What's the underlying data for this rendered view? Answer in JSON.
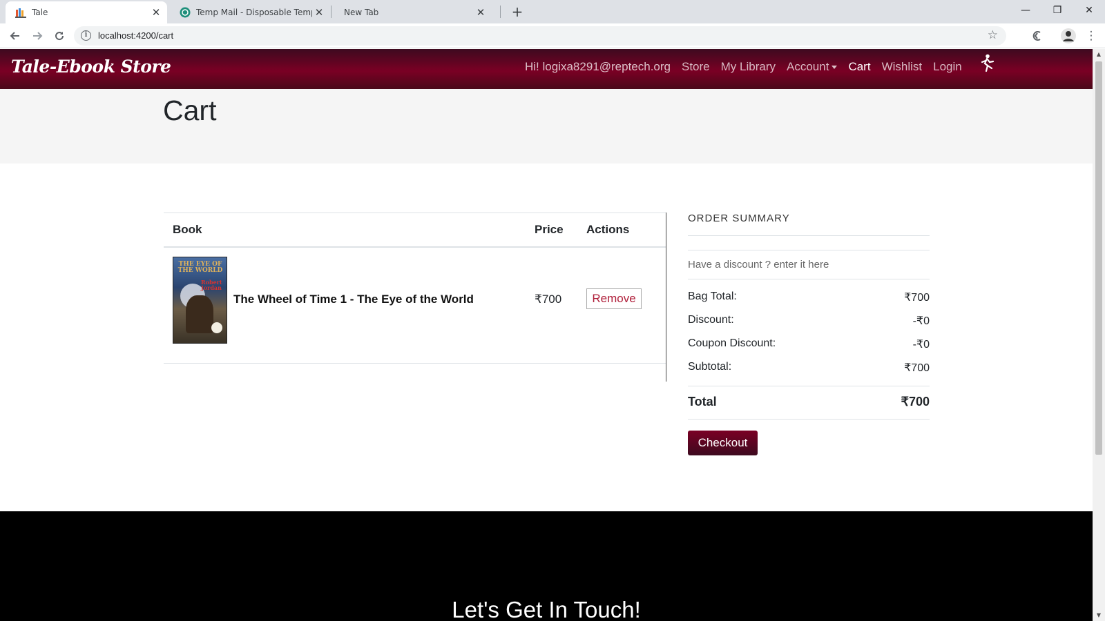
{
  "browser": {
    "tabs": [
      {
        "title": "Tale",
        "icon": "books-favicon-icon"
      },
      {
        "title": "Temp Mail - Disposable Tempora",
        "icon": "tempmail-favicon-icon"
      },
      {
        "title": "New Tab",
        "icon": ""
      }
    ],
    "url": "localhost:4200/cart",
    "window_controls": {
      "minimize": "—",
      "restore": "❐",
      "close": "✕"
    }
  },
  "navbar": {
    "brand": "Tale-Ebook Store",
    "greeting": "Hi! logixa8291@reptech.org",
    "links": [
      "Store",
      "My Library",
      "Account",
      "Cart",
      "Wishlist",
      "Login"
    ],
    "active_link": "Cart",
    "accent_color": "#7a0024"
  },
  "page": {
    "title": "Cart"
  },
  "cart": {
    "headers": {
      "book": "Book",
      "price": "Price",
      "actions": "Actions"
    },
    "items": [
      {
        "title": "The Wheel of Time 1 - The Eye of the World",
        "price": "₹700",
        "remove_label": "Remove",
        "cover": {
          "title": "THE EYE OF THE WORLD",
          "author": "Robert Jordan"
        }
      }
    ]
  },
  "summary": {
    "heading": "ORDER SUMMARY",
    "discount_prompt": "Have a discount ? enter it here",
    "rows": [
      {
        "label": "Bag Total:",
        "value": "₹700"
      },
      {
        "label": "Discount:",
        "value": "-₹0"
      },
      {
        "label": "Coupon Discount:",
        "value": "-₹0"
      },
      {
        "label": "Subtotal:",
        "value": "₹700"
      }
    ],
    "total_label": "Total",
    "total_value": "₹700",
    "checkout_label": "Checkout"
  },
  "footer": {
    "heading": "Let's Get In Touch!"
  }
}
